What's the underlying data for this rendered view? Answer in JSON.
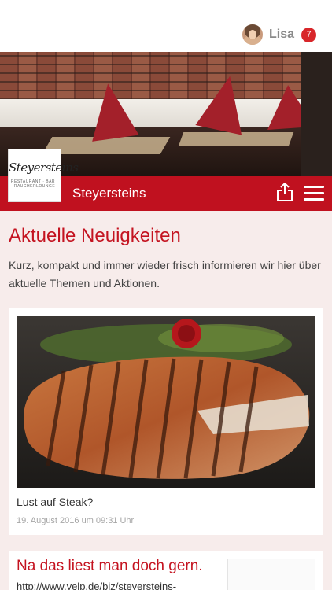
{
  "header": {
    "user_name": "Lisa",
    "notification_count": "7"
  },
  "restaurant": {
    "name": "Steyersteins",
    "logo_text": "Steyersteins",
    "logo_subtext": "RESTAURANT · BAR · RAUCHERLOUNGE"
  },
  "main": {
    "heading": "Aktuelle Neuigkeiten",
    "intro": "Kurz, kompakt und immer wieder frisch informieren wir hier über aktuelle Themen und Aktionen."
  },
  "posts": [
    {
      "title": "Lust auf Steak?",
      "date": "19. August 2016 um 09:31 Uhr"
    },
    {
      "title": "Na das liest man doch gern.",
      "url": "http://www.yelp.de/biz/steyersteins-"
    }
  ],
  "colors": {
    "accent": "#c0111f",
    "heading": "#c41320",
    "background": "#f7eceb",
    "badge": "#d8262a"
  },
  "icons": {
    "share": "share-icon",
    "menu": "hamburger-menu-icon"
  }
}
